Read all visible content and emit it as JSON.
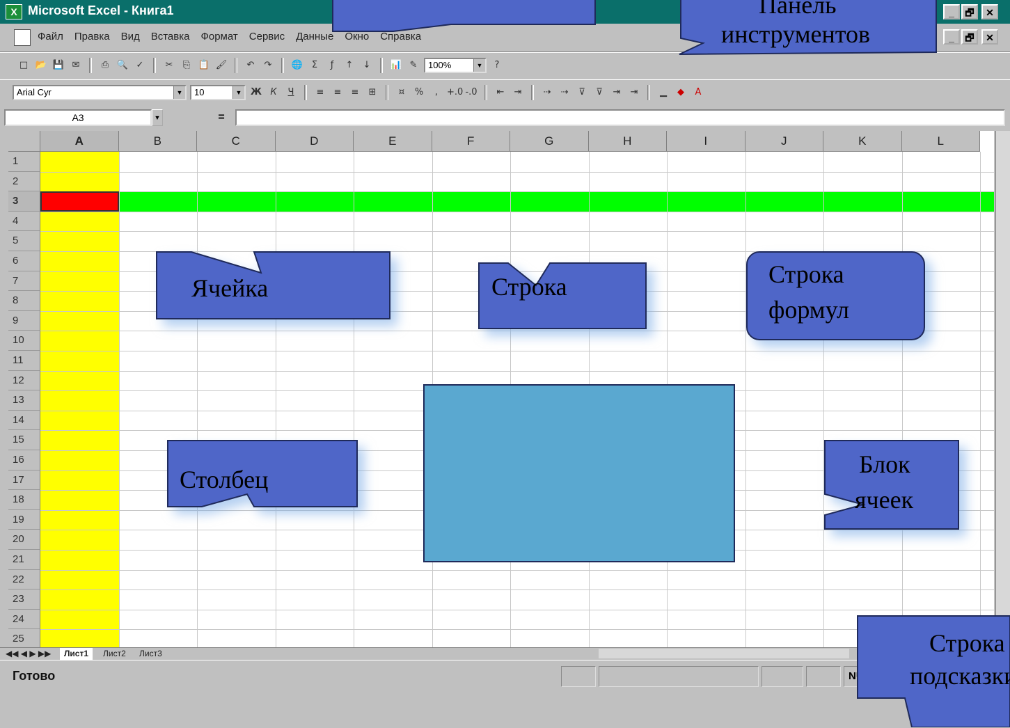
{
  "window": {
    "title": "Microsoft Excel - Книга1",
    "app_icon": "excel-icon",
    "title_controls": [
      "_",
      "🗗",
      "✕"
    ],
    "doc_controls": [
      "_",
      "🗗",
      "✕"
    ]
  },
  "menu": {
    "items": [
      "Файл",
      "Правка",
      "Вид",
      "Вставка",
      "Формат",
      "Сервис",
      "Данные",
      "Окно",
      "Справка"
    ]
  },
  "toolbar": {
    "zoom": "100%",
    "font": "Arial Cyr",
    "size": "10",
    "bold": "Ж",
    "italic": "К",
    "underline": "Ч",
    "percent": "%"
  },
  "formula_bar": {
    "name_box": "A3",
    "equals": "="
  },
  "grid": {
    "columns": [
      "A",
      "B",
      "C",
      "D",
      "E",
      "F",
      "G",
      "H",
      "I",
      "J",
      "K",
      "L"
    ],
    "rows": [
      "1",
      "2",
      "3",
      "4",
      "5",
      "6",
      "7",
      "8",
      "9",
      "10",
      "11",
      "12",
      "13",
      "14",
      "15",
      "16",
      "17",
      "18",
      "19",
      "20",
      "21",
      "22",
      "23",
      "24",
      "25"
    ],
    "active_cell": "A3",
    "highlight_column_color": "#ffff00",
    "highlight_row_color": "#00ff00",
    "active_cell_color": "#ff0000",
    "block_color": "#5aa8d0"
  },
  "sheet_tabs": [
    "Лист1",
    "Лист2",
    "Лист3"
  ],
  "status": {
    "text": "Готово",
    "num": "NUM"
  },
  "callouts": {
    "toolbar_line1": "Панель",
    "toolbar_line2": "инструментов",
    "cell": "Ячейка",
    "row": "Строка",
    "formula_line1": "Строка",
    "formula_line2": "формул",
    "column": "Столбец",
    "block_line1": "Блок",
    "block_line2": "ячеек",
    "hint_line1": "Строка",
    "hint_line2": "подсказки",
    "color": "#4f66c8"
  }
}
